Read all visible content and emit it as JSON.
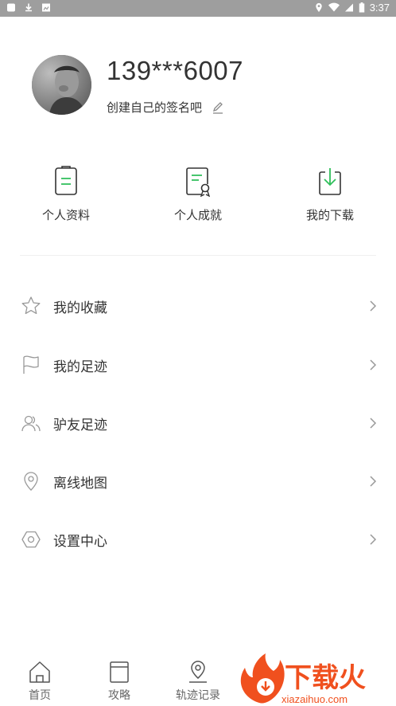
{
  "status_bar": {
    "time": "3:37"
  },
  "profile": {
    "username": "139***6007",
    "signature": "创建自己的签名吧"
  },
  "quick_actions": [
    {
      "label": "个人资料",
      "icon": "profile-document-icon"
    },
    {
      "label": "个人成就",
      "icon": "achievement-certificate-icon"
    },
    {
      "label": "我的下载",
      "icon": "download-icon"
    }
  ],
  "menu": [
    {
      "label": "我的收藏",
      "icon": "star-icon"
    },
    {
      "label": "我的足迹",
      "icon": "flag-icon"
    },
    {
      "label": "驴友足迹",
      "icon": "friends-icon"
    },
    {
      "label": "离线地图",
      "icon": "location-pin-icon"
    },
    {
      "label": "设置中心",
      "icon": "settings-hexagon-icon"
    }
  ],
  "bottom_nav": [
    {
      "label": "首页",
      "icon": "home-icon"
    },
    {
      "label": "攻略",
      "icon": "guide-book-icon"
    },
    {
      "label": "轨迹记录",
      "icon": "track-pin-icon"
    }
  ],
  "watermark": {
    "brand": "下载火",
    "url": "xiazaihuo.com"
  },
  "colors": {
    "accent_green": "#2fbf5a",
    "icon_gray": "#888888",
    "watermark_orange": "#f0501e"
  }
}
